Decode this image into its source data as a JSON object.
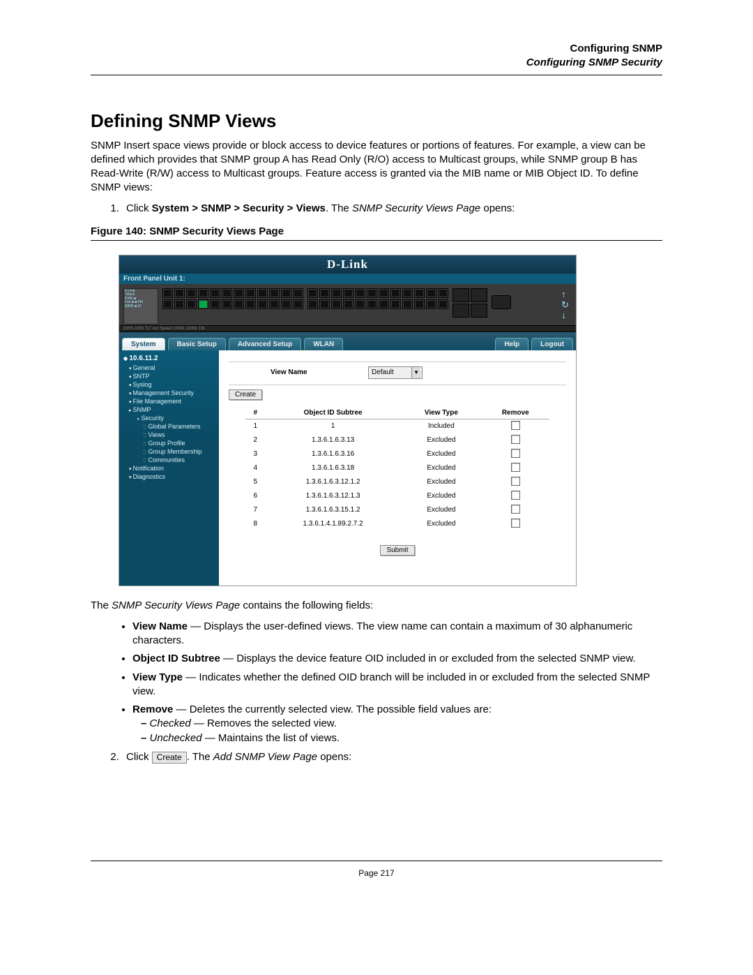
{
  "header": {
    "title": "Configuring SNMP",
    "subtitle": "Configuring SNMP Security"
  },
  "section": {
    "heading": "Defining SNMP Views",
    "intro": "SNMP Insert space views provide or block access to device features or portions of features. For example, a view can be defined which provides that SNMP group A has Read Only (R/O) access to Multicast groups, while SNMP group B has Read-Write (R/W) access to Multicast groups. Feature access is granted via the MIB name or MIB Object ID. To define SNMP views:",
    "step1_pre": "Click ",
    "step1_bold": "System > SNMP > Security > Views",
    "step1_mid": ". The ",
    "step1_ital": "SNMP Security Views Page",
    "step1_post": " opens:"
  },
  "figure": {
    "caption": "Figure 140: SNMP Security Views Page"
  },
  "screenshot": {
    "brand": "D-Link",
    "panel_label": "Front Panel Unit 1:",
    "dev_lines": [
      "D-Link",
      "•Stack",
      "PWR ■",
      "Fan ■ ■ Pkt",
      "Wfi95 ■ ID"
    ],
    "devfoot": "DWS-3250  TcT  Act Speed  1000k  1000k  10k",
    "tabs": {
      "system": "System",
      "basic": "Basic Setup",
      "advanced": "Advanced Setup",
      "wlan": "WLAN",
      "help": "Help",
      "logout": "Logout"
    },
    "sb": {
      "ip": "10.6.11.2",
      "items": [
        "General",
        "SNTP",
        "Syslog",
        "Management Security",
        "File Management",
        "SNMP"
      ],
      "snmp_sub": [
        "Security",
        "Global Parameters",
        "Views",
        "Group Profile",
        "Group Membership",
        "Communities"
      ],
      "after": [
        "Notification",
        "Diagnostics"
      ]
    },
    "content": {
      "viewname_label": "View Name",
      "viewname_value": "Default",
      "create_btn": "Create",
      "submit_btn": "Submit",
      "cols": {
        "num": "#",
        "oid": "Object ID Subtree",
        "type": "View Type",
        "remove": "Remove"
      },
      "rows": [
        {
          "n": "1",
          "oid": "1",
          "type": "Included"
        },
        {
          "n": "2",
          "oid": "1.3.6.1.6.3.13",
          "type": "Excluded"
        },
        {
          "n": "3",
          "oid": "1.3.6.1.6.3.16",
          "type": "Excluded"
        },
        {
          "n": "4",
          "oid": "1.3.6.1.6.3.18",
          "type": "Excluded"
        },
        {
          "n": "5",
          "oid": "1.3.6.1.6.3.12.1.2",
          "type": "Excluded"
        },
        {
          "n": "6",
          "oid": "1.3.6.1.6.3.12.1.3",
          "type": "Excluded"
        },
        {
          "n": "7",
          "oid": "1.3.6.1.6.3.15.1.2",
          "type": "Excluded"
        },
        {
          "n": "8",
          "oid": "1.3.6.1.4.1.89.2.7.2",
          "type": "Excluded"
        }
      ]
    }
  },
  "after": {
    "lead_pre": "The ",
    "lead_ital": "SNMP Security Views Page",
    "lead_post": " contains the following fields:",
    "b1_t": "View Name",
    "b1_d": " — Displays the user-defined views. The view name can contain a maximum of 30 alphanumeric characters.",
    "b2_t": "Object ID Subtree",
    "b2_d": " — Displays the device feature OID included in or excluded from the selected SNMP view.",
    "b3_t": "View Type",
    "b3_d": " — Indicates whether the defined OID branch will be included in or excluded from the selected SNMP view.",
    "b4_t": "Remove",
    "b4_d": " — Deletes the currently selected view. The possible field values are:",
    "b4_s1_i": "Checked",
    "b4_s1_d": " — Removes the selected view.",
    "b4_s2_i": "Unchecked",
    "b4_s2_d": " — Maintains the list of views.",
    "step2_pre": "Click ",
    "step2_btn": "Create",
    "step2_mid": ". The ",
    "step2_ital": "Add SNMP View Page",
    "step2_post": " opens:"
  },
  "footer": {
    "page": "Page 217"
  }
}
